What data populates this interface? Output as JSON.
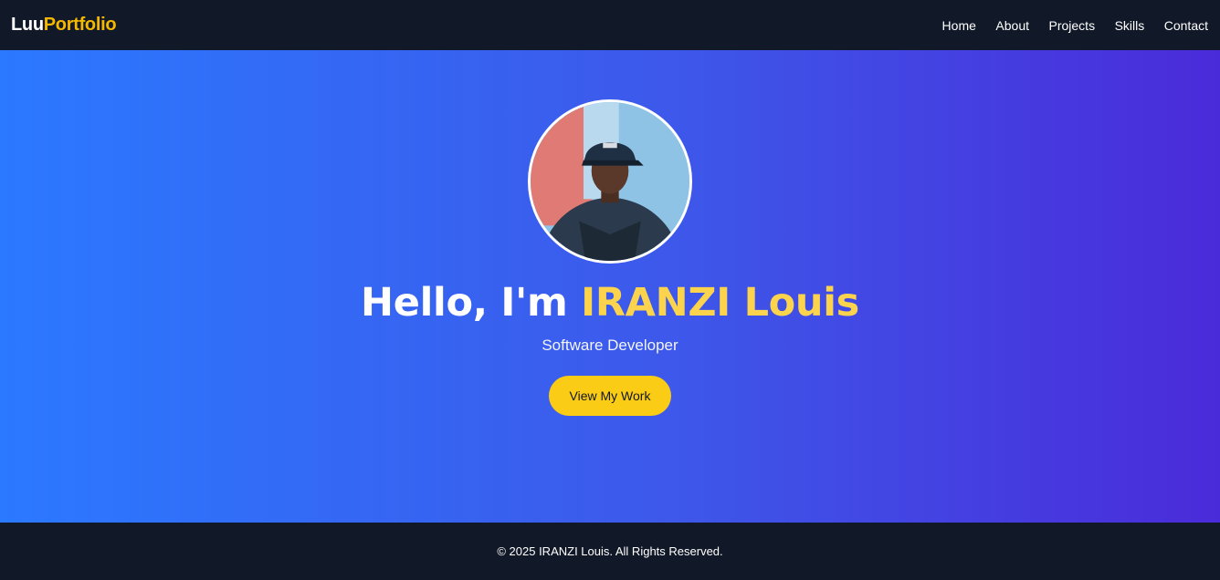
{
  "brand": {
    "first": "Luu",
    "second": "Portfolio"
  },
  "nav": {
    "items": [
      "Home",
      "About",
      "Projects",
      "Skills",
      "Contact"
    ]
  },
  "hero": {
    "greeting": "Hello, I'm ",
    "name": "IRANZI Louis",
    "subtitle": "Software Developer",
    "cta_label": "View My Work"
  },
  "footer": {
    "text": "© 2025 IRANZI Louis. All Rights Reserved."
  },
  "colors": {
    "accent": "#facc15",
    "nav_bg": "#111827",
    "gradient_start": "#2b79ff",
    "gradient_end": "#4a2bd9"
  }
}
